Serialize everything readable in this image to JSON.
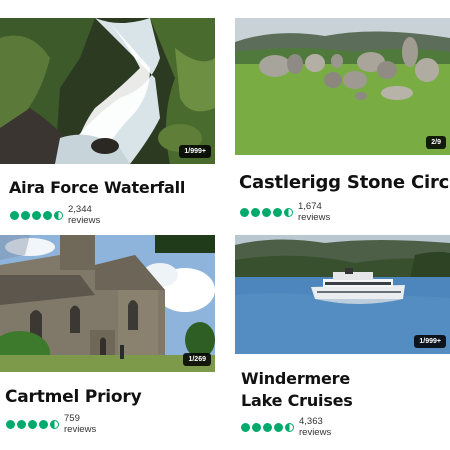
{
  "colors": {
    "rating": "#00aa6c",
    "badge_bg": "#000000"
  },
  "cards": [
    {
      "title": "Aira Force Waterfall",
      "rating": 4.5,
      "reviews": "2,344 reviews",
      "photo_count": "1/999+"
    },
    {
      "title": "Castlerigg Stone Circle",
      "rating": 4.5,
      "reviews": "1,674 reviews",
      "photo_count": "2/9"
    },
    {
      "title": "Cartmel Priory",
      "rating": 4.5,
      "reviews": "759 reviews",
      "photo_count": "1/269"
    },
    {
      "title_line1": "Windermere",
      "title_line2": "Lake Cruises",
      "rating": 4.5,
      "reviews": "4,363 reviews",
      "photo_count": "1/999+"
    }
  ]
}
